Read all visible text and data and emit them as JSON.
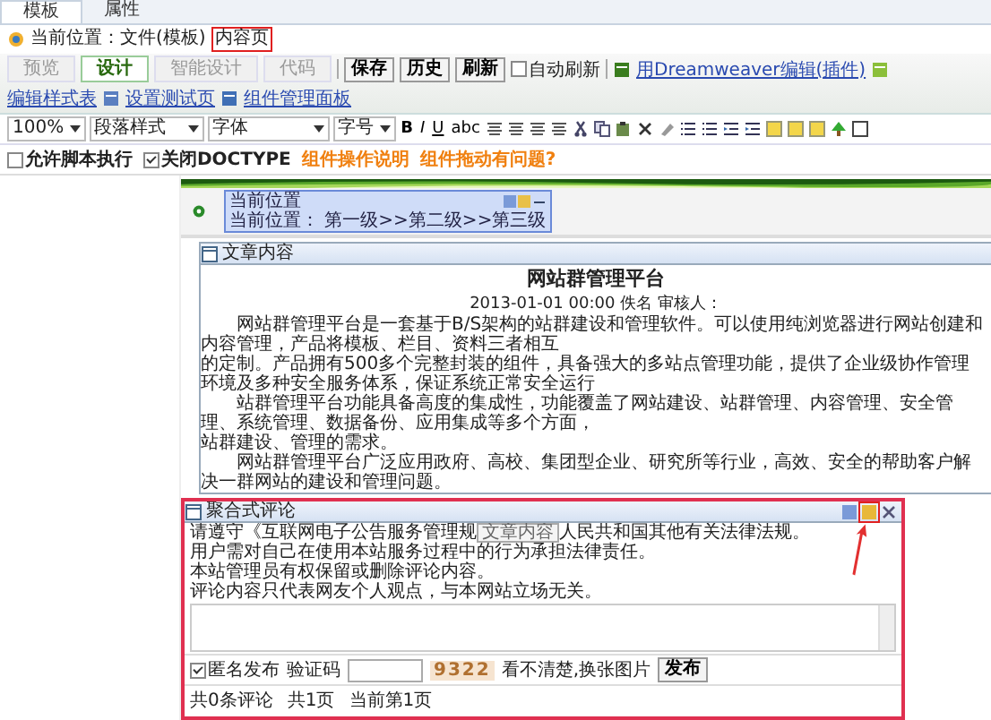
{
  "editor_tabs": [
    {
      "label": "模板",
      "selected": true
    },
    {
      "label": "属性",
      "selected": false
    }
  ],
  "location": {
    "label": "当前位置：文件(模板)",
    "current": "内容页"
  },
  "view_tabs": [
    {
      "label": "预览",
      "selected": false
    },
    {
      "label": "设计",
      "selected": true
    },
    {
      "label": "智能设计",
      "selected": false
    },
    {
      "label": "代码",
      "selected": false
    }
  ],
  "actions": [
    "保存",
    "历史",
    "刷新"
  ],
  "auto_refresh": {
    "label": "自动刷新",
    "checked": false
  },
  "links": [
    {
      "label": "用Dreamweaver编辑(插件)",
      "kind": "dreamweaver"
    },
    {
      "label": "编辑样式表",
      "kind": "stylesheet"
    },
    {
      "label": "设置测试页",
      "kind": "testpage"
    },
    {
      "label": "组件管理面板",
      "kind": "panel"
    }
  ],
  "format": {
    "zoom": "100%",
    "paragraph": "段落样式",
    "font": "字体",
    "size": "字号",
    "text_buttons": [
      "B",
      "I",
      "U",
      "abc"
    ]
  },
  "options": [
    {
      "label": "允许脚本执行",
      "checked": false
    },
    {
      "label": "关闭DOCTYPE",
      "checked": true
    }
  ],
  "help_links": [
    "组件操作说明",
    "组件拖动有问题?"
  ],
  "breadcrumb_widget": {
    "title": "当前位置",
    "text": "当前位置： 第一级>>第二级>>第三级"
  },
  "article": {
    "panel_title": "文章内容",
    "title": "网站群管理平台",
    "meta": "2013-01-01 00:00 佚名  审核人：",
    "lines": [
      {
        "text": "网站群管理平台是一套基于B/S架构的站群建设和管理软件。可以使用纯浏览器进行网站创建和内容管理，产品将模板、栏目、资料三者相互",
        "indent": true
      },
      {
        "text": "的定制。产品拥有500多个完整封装的组件，具备强大的多站点管理功能，提供了企业级协作管理环境及多种安全服务体系，保证系统正常安全运行",
        "indent": false
      },
      {
        "text": "站群管理平台功能具备高度的集成性，功能覆盖了网站建设、站群管理、内容管理、安全管理、系统管理、数据备份、应用集成等多个方面，",
        "indent": true
      },
      {
        "text": "站群建设、管理的需求。",
        "indent": false
      },
      {
        "text": "网站群管理平台广泛应用政府、高校、集团型企业、研究所等行业，高效、安全的帮助客户解决一群网站的建设和管理问题。",
        "indent": true
      }
    ]
  },
  "comments": {
    "panel_title": "聚合式评论",
    "tooltip": "文章内容",
    "notice_first": {
      "before": "请遵守《互联网电子公告服务管理规",
      "after": "人民共和国其他有关法律法规。"
    },
    "notice": [
      "用户需对自己在使用本站服务过程中的行为承担法律责任。",
      "本站管理员有权保留或删除评论内容。",
      "评论内容只代表网友个人观点，与本网站立场无关。"
    ],
    "anonymous": {
      "label": "匿名发布",
      "checked": true
    },
    "captcha_label": "验证码",
    "captcha": "9322",
    "refresh_captcha": "看不清楚,换张图片",
    "submit": "发布",
    "summary": [
      "共0条评论",
      "共1页",
      "当前第1页"
    ]
  }
}
